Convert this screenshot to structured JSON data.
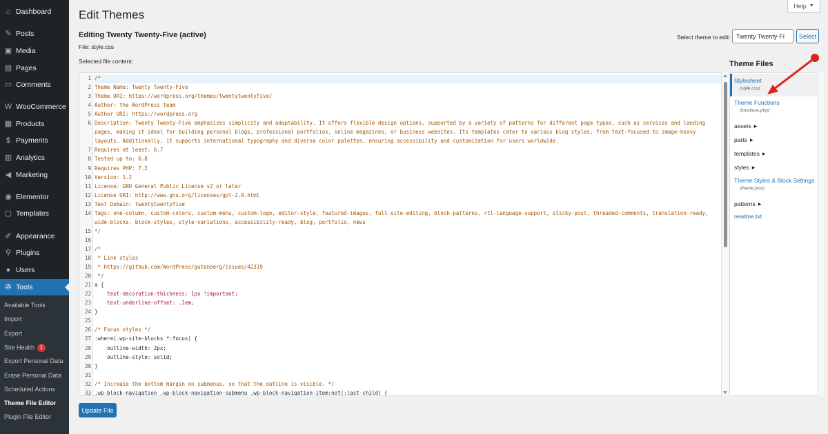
{
  "sidebar": {
    "items": [
      {
        "label": "Dashboard",
        "icon": "dashboard-icon",
        "glyph": "⌂"
      },
      {
        "label": "Posts",
        "icon": "pin-icon",
        "glyph": "✎"
      },
      {
        "label": "Media",
        "icon": "media-icon",
        "glyph": "▣"
      },
      {
        "label": "Pages",
        "icon": "pages-icon",
        "glyph": "▤"
      },
      {
        "label": "Comments",
        "icon": "comments-icon",
        "glyph": "▭"
      },
      {
        "label": "WooCommerce",
        "icon": "woocommerce-icon",
        "glyph": "W"
      },
      {
        "label": "Products",
        "icon": "products-icon",
        "glyph": "▦"
      },
      {
        "label": "Payments",
        "icon": "payments-icon",
        "glyph": "$"
      },
      {
        "label": "Analytics",
        "icon": "analytics-icon",
        "glyph": "▥"
      },
      {
        "label": "Marketing",
        "icon": "megaphone-icon",
        "glyph": "◀"
      },
      {
        "label": "Elementor",
        "icon": "elementor-icon",
        "glyph": "◉"
      },
      {
        "label": "Templates",
        "icon": "templates-icon",
        "glyph": "▢"
      },
      {
        "label": "Appearance",
        "icon": "brush-icon",
        "glyph": "✐"
      },
      {
        "label": "Plugins",
        "icon": "plugin-icon",
        "glyph": "⚲"
      },
      {
        "label": "Users",
        "icon": "user-icon",
        "glyph": "●"
      },
      {
        "label": "Tools",
        "icon": "wrench-icon",
        "glyph": "✇",
        "current": true
      }
    ],
    "submenu": [
      {
        "label": "Available Tools"
      },
      {
        "label": "Import"
      },
      {
        "label": "Export"
      },
      {
        "label": "Site Health",
        "badge": "1"
      },
      {
        "label": "Export Personal Data"
      },
      {
        "label": "Erase Personal Data"
      },
      {
        "label": "Scheduled Actions"
      },
      {
        "label": "Theme File Editor",
        "current": true
      },
      {
        "label": "Plugin File Editor"
      }
    ]
  },
  "header": {
    "help_label": "Help",
    "page_title": "Edit Themes",
    "editing_title": "Editing Twenty Twenty-Five (active)",
    "file_label": "File: style.css",
    "selected_label": "Selected file content:",
    "select_theme_label": "Select theme to edit:",
    "theme_select_value": "Twenty Twenty-Fi",
    "select_button": "Select"
  },
  "editor": {
    "rows": [
      {
        "n": "1",
        "text": "/*"
      },
      {
        "n": "2",
        "text": "Theme Name: Twenty Twenty-Five"
      },
      {
        "n": "3",
        "text": "Theme URI: https://wordpress.org/themes/twentytwentyfive/"
      },
      {
        "n": "4",
        "text": "Author: the WordPress team"
      },
      {
        "n": "5",
        "text": "Author URI: https://wordpress.org"
      },
      {
        "n": "6",
        "text": "Description: Twenty Twenty-Five emphasizes simplicity and adaptability. It offers flexible design options, supported by a variety of patterns for different page types, such as services and landing"
      },
      {
        "n": "",
        "text": "pages, making it ideal for building personal blogs, professional portfolios, online magazines, or business websites. Its templates cater to various blog styles, from text-focused to image-heavy"
      },
      {
        "n": "",
        "text": "layouts. Additionally, it supports international typography and diverse color palettes, ensuring accessibility and customization for users worldwide."
      },
      {
        "n": "7",
        "text": "Requires at least: 6.7"
      },
      {
        "n": "8",
        "text": "Tested up to: 6.8"
      },
      {
        "n": "9",
        "text": "Requires PHP: 7.2"
      },
      {
        "n": "10",
        "text": "Version: 1.2"
      },
      {
        "n": "11",
        "text": "License: GNU General Public License v2 or later"
      },
      {
        "n": "12",
        "text": "License URI: http://www.gnu.org/licenses/gpl-2.0.html"
      },
      {
        "n": "13",
        "text": "Text Domain: twentytwentyfive"
      },
      {
        "n": "14",
        "text": "Tags: one-column, custom-colors, custom-menu, custom-logo, editor-style, featured-images, full-site-editing, block-patterns, rtl-language-support, sticky-post, threaded-comments, translation-ready,"
      },
      {
        "n": "",
        "text": "wide-blocks, block-styles, style-variations, accessibility-ready, blog, portfolio, news"
      },
      {
        "n": "15",
        "text": "*/"
      },
      {
        "n": "16",
        "text": ""
      },
      {
        "n": "17",
        "text": "/*"
      },
      {
        "n": "18",
        "text": " * Link styles"
      },
      {
        "n": "19",
        "text": " * https://github.com/WordPress/gutenberg/issues/42319"
      },
      {
        "n": "20",
        "text": " */"
      },
      {
        "n": "21",
        "text": "a {",
        "kind": "sel"
      },
      {
        "n": "22",
        "text": "    text-decoration-thickness: 1px !important;",
        "kind": "prop"
      },
      {
        "n": "23",
        "text": "    text-underline-offset: .1em;",
        "kind": "prop"
      },
      {
        "n": "24",
        "text": "}",
        "kind": "punct"
      },
      {
        "n": "25",
        "text": ""
      },
      {
        "n": "26",
        "text": "/* Focus styles */"
      },
      {
        "n": "27",
        "text": ":where(.wp-site-blocks *:focus) {",
        "kind": "sel"
      },
      {
        "n": "28",
        "text": "    outline-width: 2px;",
        "kind": "sel"
      },
      {
        "n": "29",
        "text": "    outline-style: solid;",
        "kind": "sel"
      },
      {
        "n": "30",
        "text": "}",
        "kind": "punct"
      },
      {
        "n": "31",
        "text": ""
      },
      {
        "n": "32",
        "text": "/* Increase the bottom margin on submenus, so that the outline is visible. */"
      },
      {
        "n": "33",
        "text": ".wp-block-navigation .wp-block-navigation-submenu .wp-block-navigation-item:not(:last-child) {",
        "kind": "sel"
      }
    ]
  },
  "update_button": "Update File",
  "files": {
    "heading": "Theme Files",
    "entries": [
      {
        "type": "file",
        "label": "Stylesheet",
        "sub": "(style.css)",
        "active": true
      },
      {
        "type": "file",
        "label": "Theme Functions",
        "sub": "(functions.php)"
      },
      {
        "type": "folder",
        "label": "assets"
      },
      {
        "type": "folder",
        "label": "parts"
      },
      {
        "type": "folder",
        "label": "templates"
      },
      {
        "type": "folder",
        "label": "styles"
      },
      {
        "type": "file",
        "label": "Theme Styles & Block Settings",
        "sub": "(theme.json)"
      },
      {
        "type": "folder",
        "label": "patterns"
      },
      {
        "type": "file",
        "label": "readme.txt"
      }
    ]
  },
  "colors": {
    "sidebar_bg": "#1d2327",
    "accent": "#2271b1",
    "annotation_arrow": "#e0201d",
    "code_text": "#a35200"
  }
}
